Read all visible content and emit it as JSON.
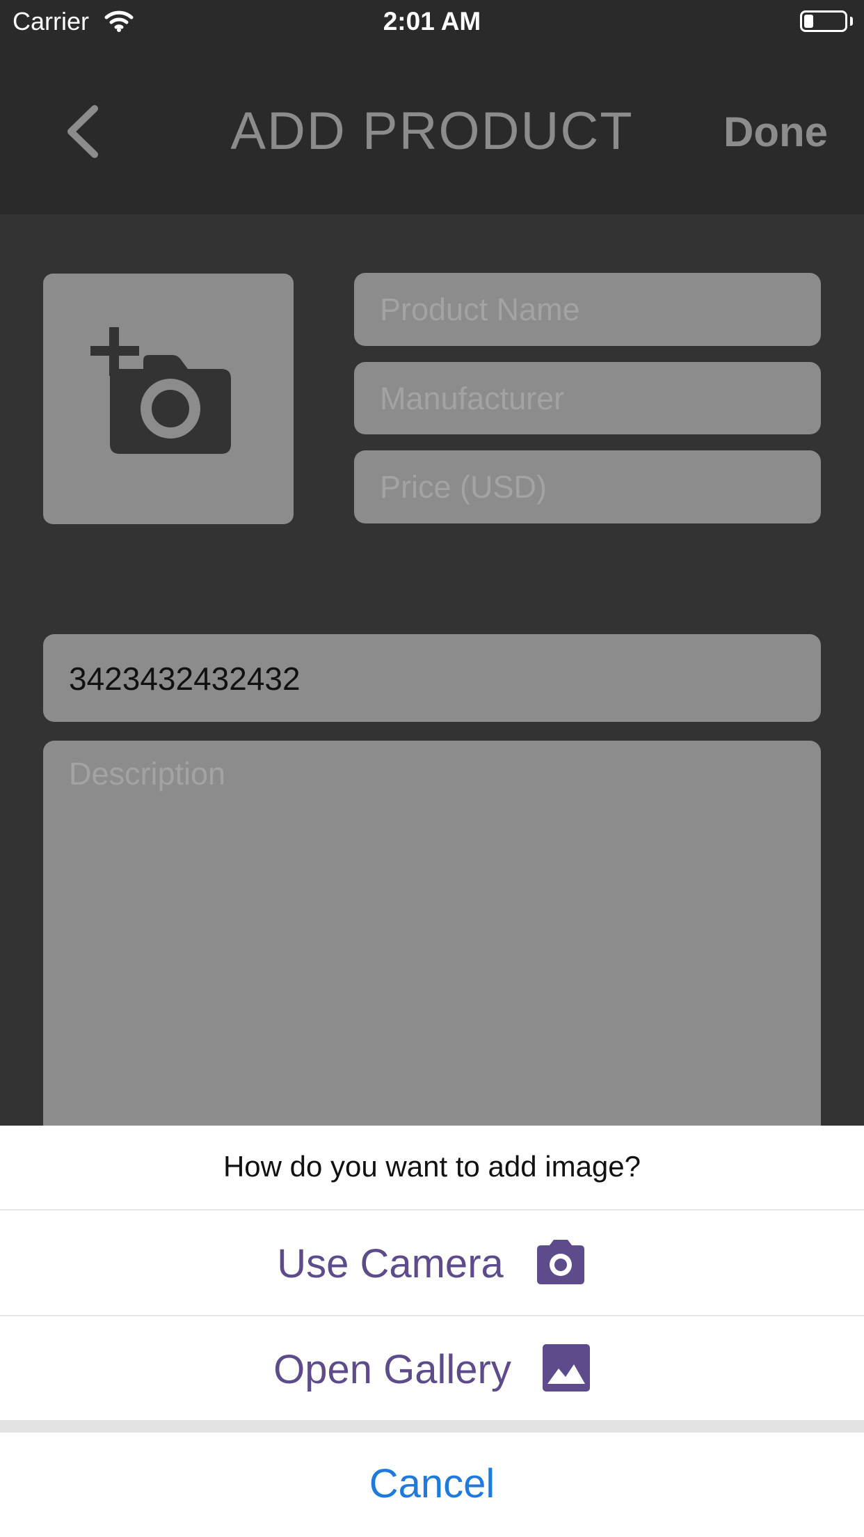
{
  "status_bar": {
    "carrier": "Carrier",
    "time": "2:01 AM",
    "battery_level_pct": 15
  },
  "nav": {
    "title": "ADD PRODUCT",
    "done_label": "Done",
    "back_icon": "chevron-left-icon"
  },
  "form": {
    "photo_icon": "add-photo-icon",
    "product_name_placeholder": "Product Name",
    "manufacturer_placeholder": "Manufacturer",
    "price_placeholder": "Price (USD)",
    "barcode_value": "3423432432432",
    "description_placeholder": "Description"
  },
  "action_sheet": {
    "title": "How do you want to add image?",
    "use_camera_label": "Use Camera",
    "open_gallery_label": "Open Gallery",
    "cancel_label": "Cancel",
    "camera_icon": "camera-icon",
    "gallery_icon": "image-icon"
  },
  "colors": {
    "background": "#333333",
    "field": "#8c8c8c",
    "accent_purple": "#5d4b8c",
    "cancel_blue": "#1f7ae0"
  }
}
